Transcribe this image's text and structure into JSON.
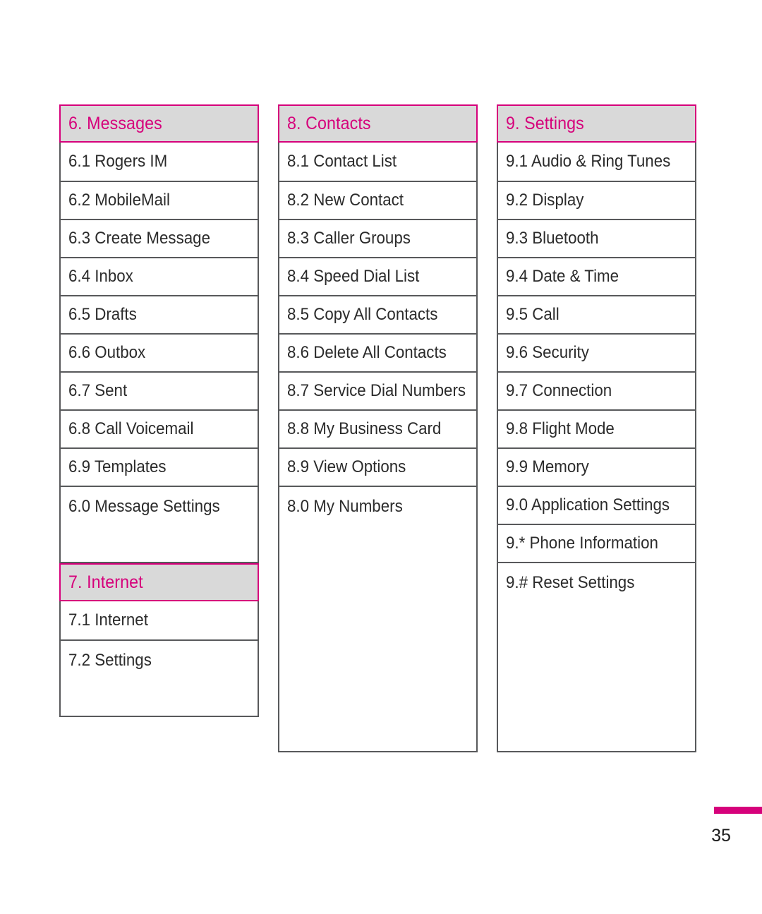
{
  "document": {
    "page_number": "35",
    "accent_color": "#d6017b",
    "header_background": "#d9d9d9",
    "border_color": "#58595b",
    "text_color": "#2b2b2b"
  },
  "columns": [
    {
      "blocks": [
        {
          "header": "6. Messages",
          "items": [
            "6.1 Rogers IM",
            "6.2 MobileMail",
            "6.3 Create Message",
            "6.4 Inbox",
            "6.5 Drafts",
            "6.6 Outbox",
            "6.7 Sent",
            "6.8 Call Voicemail",
            "6.9 Templates",
            "6.0 Message Settings"
          ]
        },
        {
          "header": "7. Internet",
          "items": [
            "7.1 Internet",
            "7.2 Settings"
          ]
        }
      ]
    },
    {
      "blocks": [
        {
          "header": "8. Contacts",
          "items": [
            "8.1 Contact List",
            "8.2 New Contact",
            "8.3 Caller Groups",
            "8.4 Speed Dial List",
            "8.5 Copy All Contacts",
            "8.6 Delete All Contacts",
            "8.7 Service Dial Numbers",
            "8.8 My Business Card",
            "8.9 View Options",
            "8.0 My Numbers"
          ]
        }
      ]
    },
    {
      "blocks": [
        {
          "header": "9. Settings",
          "items": [
            "9.1 Audio & Ring Tunes",
            "9.2 Display",
            "9.3 Bluetooth",
            "9.4 Date & Time",
            "9.5 Call",
            "9.6 Security",
            "9.7 Connection",
            "9.8 Flight Mode",
            "9.9 Memory",
            "9.0 Application Settings",
            "9.* Phone Information",
            "9.# Reset Settings"
          ]
        }
      ]
    }
  ]
}
